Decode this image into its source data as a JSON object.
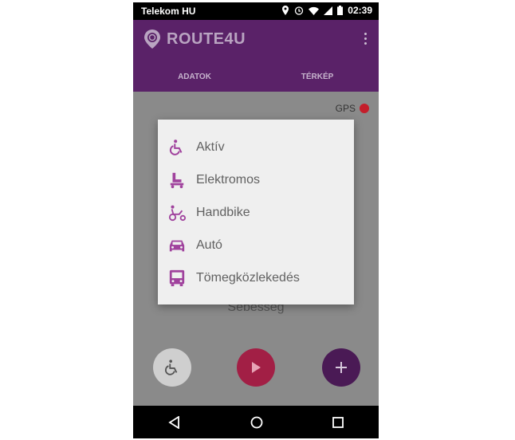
{
  "status_bar": {
    "carrier": "Telekom HU",
    "time": "02:39"
  },
  "app": {
    "logo_text": "ROUTE4U"
  },
  "tabs": [
    {
      "label": "ADATOK"
    },
    {
      "label": "TÉRKÉP"
    }
  ],
  "content": {
    "gps_label": "GPS",
    "speed_label_partial": "Sebesség"
  },
  "dialog": {
    "options": [
      {
        "label": "Aktív",
        "icon": "wheelchair-icon"
      },
      {
        "label": "Elektromos",
        "icon": "power-wheelchair-icon"
      },
      {
        "label": "Handbike",
        "icon": "handbike-icon"
      },
      {
        "label": "Autó",
        "icon": "car-icon"
      },
      {
        "label": "Tömegközlekedés",
        "icon": "bus-icon"
      }
    ]
  },
  "colors": {
    "primary": "#5a2268",
    "accent": "#a0429d",
    "gps": "#c41e2b",
    "play": "#a21f45"
  }
}
